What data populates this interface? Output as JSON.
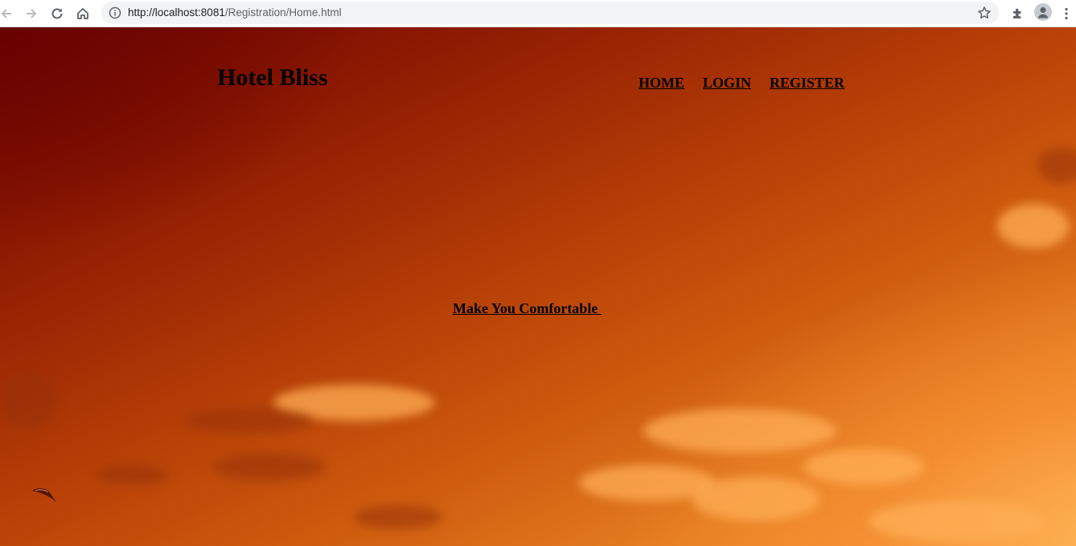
{
  "browser": {
    "url_host": "http://localhost:8081",
    "url_path": "/Registration/Home.html",
    "icons": {
      "back": "arrow-left-icon",
      "forward": "arrow-right-icon",
      "reload": "reload-icon",
      "home": "home-icon",
      "info": "info-icon",
      "bookmark": "star-icon",
      "extensions": "puzzle-icon",
      "profile": "person-icon",
      "menu": "kebab-menu-icon"
    }
  },
  "page": {
    "brand": "Hotel Bliss",
    "nav": {
      "home": "HOME",
      "login": "LOGIN",
      "register": "REGISTER"
    },
    "tagline": "Make You Comfortable ",
    "colors": {
      "text": "#000000",
      "sky_top": "#6d0502",
      "sky_bottom": "#f59b3b"
    }
  }
}
